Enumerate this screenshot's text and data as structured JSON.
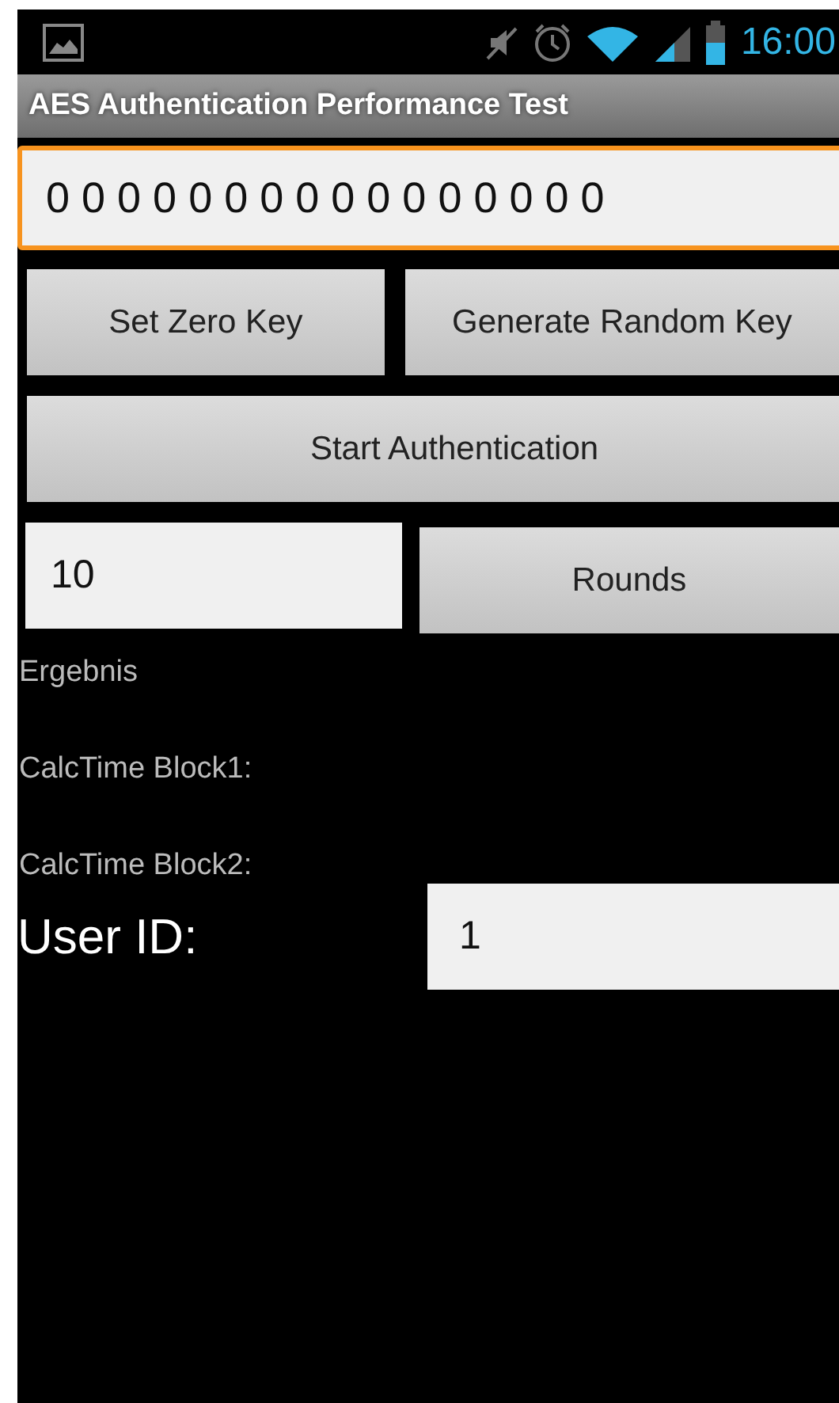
{
  "status_bar": {
    "time": "16:00"
  },
  "app_bar": {
    "title": "AES Authentication Performance Test"
  },
  "key_field": {
    "value": "0 0 0 0 0 0 0 0 0 0 0 0 0 0 0 0",
    "focused": true
  },
  "key_buttons": [
    {
      "label": "Set Zero Key"
    },
    {
      "label": "Generate Random Key"
    }
  ],
  "start_button": {
    "label": "Start Authentication"
  },
  "rounds": {
    "value": "10",
    "focused": false,
    "button": "Rounds"
  },
  "results": [
    {
      "label": "Ergebnis"
    },
    {
      "label": "CalcTime Block1:"
    },
    {
      "label": "CalcTime Block2:"
    }
  ],
  "user_id": {
    "label": "User ID:",
    "value": "1",
    "focused": false
  }
}
